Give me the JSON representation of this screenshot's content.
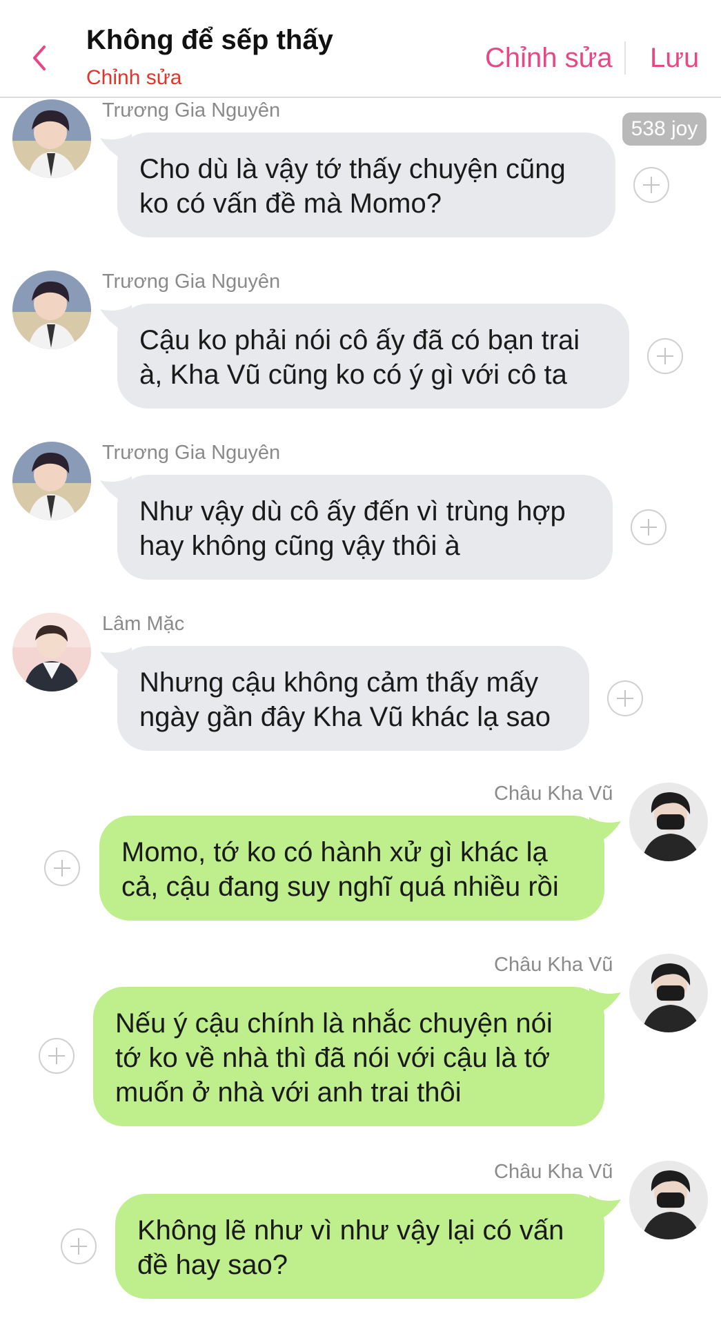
{
  "header": {
    "title": "Không để sếp thấy",
    "subtitle": "Chỉnh sửa",
    "edit_label": "Chỉnh sửa",
    "save_label": "Lưu",
    "accent_color": "#e84785",
    "back_icon": "chevron-left-icon"
  },
  "joy_badge": "538 joy",
  "messages": [
    {
      "side": "left",
      "sender": "Trương Gia Nguyên",
      "lines": [
        "Cho dù là vậy tớ thấy chuyện cũng",
        "ko có vấn đề mà Momo?"
      ]
    },
    {
      "side": "left",
      "sender": "Trương Gia Nguyên",
      "lines": [
        "Cậu ko phải nói cô ấy đã có bạn trai",
        "à, Kha Vũ cũng ko có ý gì với cô ta"
      ]
    },
    {
      "side": "left",
      "sender": "Trương Gia Nguyên",
      "lines": [
        "Như vậy dù cô ấy đến vì trùng hợp",
        "hay không cũng vậy thôi à"
      ]
    },
    {
      "side": "left",
      "sender": "Lâm Mặc",
      "lines": [
        "Nhưng cậu không cảm thấy mấy",
        "ngày gần đây Kha Vũ khác lạ sao"
      ]
    },
    {
      "side": "right",
      "sender": "Châu Kha Vũ",
      "lines": [
        "Momo, tớ ko có hành xử gì khác lạ",
        "cả, cậu đang suy nghĩ quá nhiều rồi"
      ]
    },
    {
      "side": "right",
      "sender": "Châu Kha Vũ",
      "lines": [
        "Nếu ý cậu chính là nhắc chuyện nói",
        "tớ ko về nhà thì đã nói với cậu là tớ",
        "muốn ở nhà với anh trai thôi"
      ]
    },
    {
      "side": "right",
      "sender": "Châu Kha Vũ",
      "lines": [
        "Không lẽ như vì như vậy lại có vấn",
        "đề hay sao?"
      ]
    }
  ],
  "colors": {
    "left_bubble": "#e7e9ec",
    "right_bubble": "#bfee8c",
    "sender_text": "#8a8a8a",
    "subtitle": "#e0352b"
  }
}
